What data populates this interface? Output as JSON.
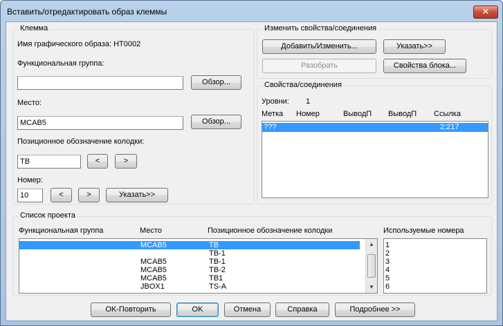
{
  "window": {
    "title": "Вставить/отредактировать образ клеммы",
    "close_glyph": "✕"
  },
  "terminal": {
    "group_title": "Клемма",
    "graphic_name_label": "Имя графического образа: HT0002",
    "func_group_label": "Функциональная группа:",
    "func_group_value": "",
    "browse1": "Обзор...",
    "location_label": "Место:",
    "location_value": "MCAB5",
    "browse2": "Обзор...",
    "strip_label": "Позиционное обозначение колодки:",
    "strip_value": "TB",
    "strip_prev": "<",
    "strip_next": ">",
    "number_label": "Номер:",
    "number_value": "10",
    "num_prev": "<",
    "num_next": ">",
    "pick": "Указать>>"
  },
  "change_props": {
    "group_title": "Изменить свойства/соединения",
    "add_edit": "Добавить/Изменить...",
    "pick": "Указать>>",
    "disassemble": "Разобрать",
    "block_props": "Свойства блока..."
  },
  "props_conn": {
    "group_title": "Свойства/соединения",
    "levels_label": "Уровни:",
    "levels_value": "1",
    "columns": [
      "Метка",
      "Номер",
      "ВыводП",
      "ВыводП",
      "Ссылка"
    ],
    "rows": [
      {
        "mark": "???",
        "number": "",
        "out1": "",
        "out2": "",
        "ref": "2;217"
      }
    ]
  },
  "project_list": {
    "group_title": "Список проекта",
    "columns": [
      "Функциональная группа",
      "Место",
      "Позиционное обозначение колодки"
    ],
    "rows": [
      {
        "func": "",
        "loc": "MCAB5",
        "strip": "TB"
      },
      {
        "func": "",
        "loc": "",
        "strip": "TB-1"
      },
      {
        "func": "",
        "loc": "MCAB5",
        "strip": "TB-1"
      },
      {
        "func": "",
        "loc": "MCAB5",
        "strip": "TB-2"
      },
      {
        "func": "",
        "loc": "MCAB5",
        "strip": "TB1"
      },
      {
        "func": "",
        "loc": "JBOX1",
        "strip": "TS-A"
      }
    ],
    "used_numbers_label": "Используемые номера",
    "used_numbers": [
      "1",
      "2",
      "3",
      "4",
      "5",
      "6"
    ]
  },
  "footer": {
    "ok_repeat": "OK-Повторить",
    "ok": "OK",
    "cancel": "Отмена",
    "help": "Справка",
    "details": "Подробнее >>"
  }
}
